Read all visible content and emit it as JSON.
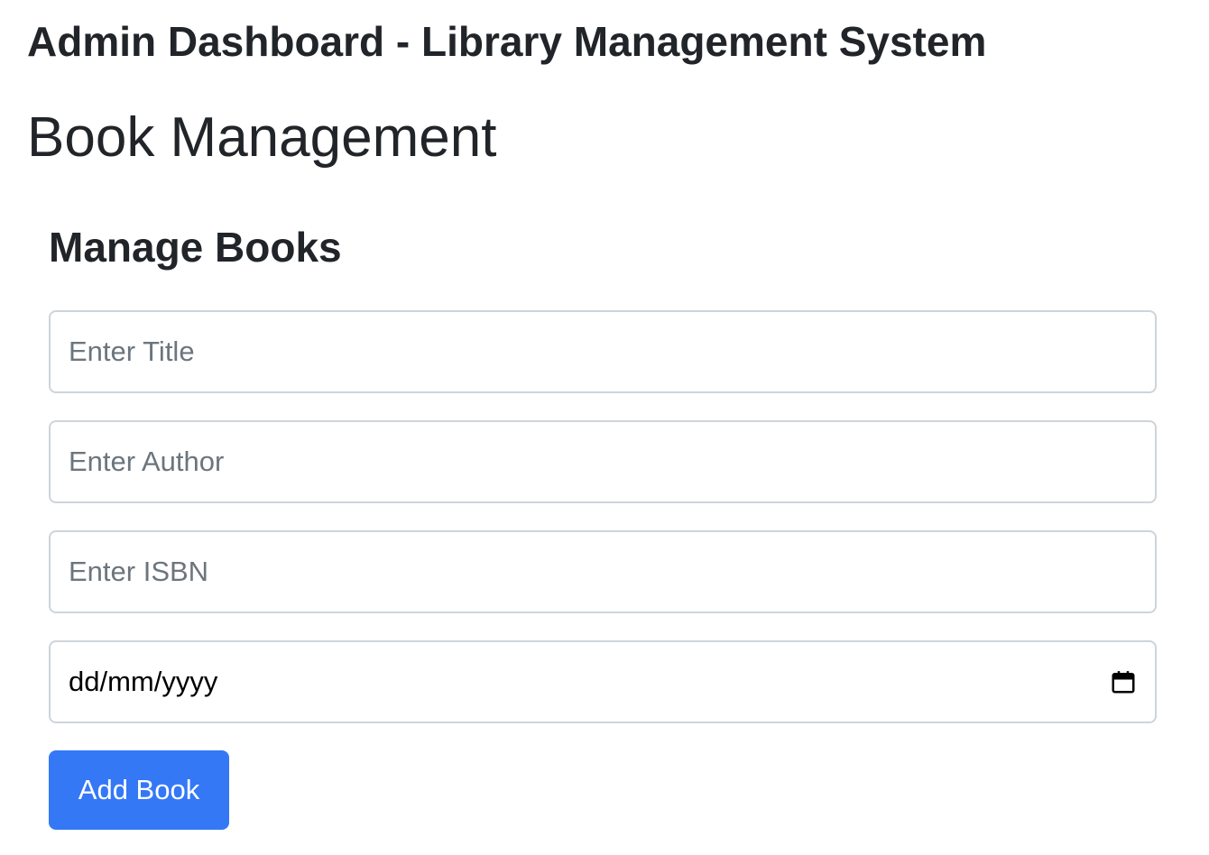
{
  "header": {
    "title": "Admin Dashboard - Library Management System"
  },
  "section": {
    "title": "Book Management"
  },
  "form": {
    "heading": "Manage Books",
    "title_placeholder": "Enter Title",
    "author_placeholder": "Enter Author",
    "isbn_placeholder": "Enter ISBN",
    "date_placeholder": "dd/mm/yyyy",
    "date_icon": "calendar-icon",
    "submit_label": "Add Book"
  },
  "colors": {
    "primary_button": "#3478f6",
    "text": "#212529",
    "placeholder": "#6c757d",
    "input_border": "#ced4da"
  }
}
